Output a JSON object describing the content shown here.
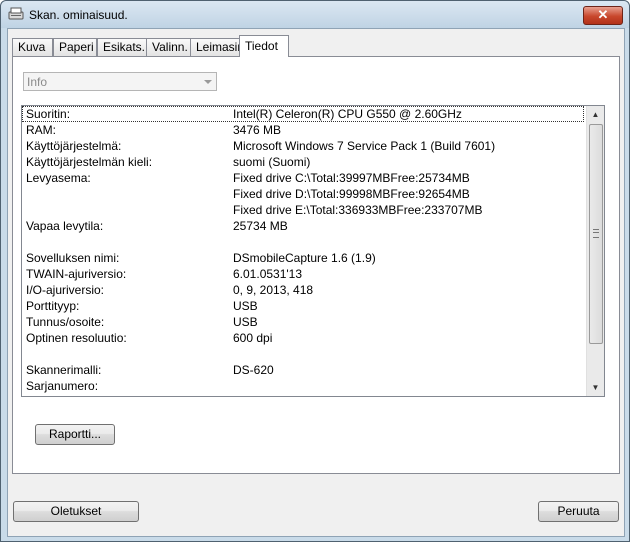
{
  "window": {
    "title": "Skan. ominaisuud.",
    "close_label": "✕"
  },
  "tabs": [
    {
      "label": "Kuva"
    },
    {
      "label": "Paperi"
    },
    {
      "label": "Esikats."
    },
    {
      "label": "Valinn."
    },
    {
      "label": "Leimasin"
    },
    {
      "label": "Tiedot",
      "active": true
    }
  ],
  "info_dropdown": {
    "selected": "Info"
  },
  "info_list": {
    "rows": [
      {
        "label": "Suoritin:",
        "value": "Intel(R) Celeron(R) CPU G550 @ 2.60GHz"
      },
      {
        "label": "RAM:",
        "value": "3476 MB"
      },
      {
        "label": "Käyttöjärjestelmä:",
        "value": "Microsoft Windows 7 Service Pack 1 (Build 7601)"
      },
      {
        "label": "Käyttöjärjestelmän kieli:",
        "value": "suomi (Suomi)"
      },
      {
        "label": "Levyasema:",
        "value": "Fixed drive C:\\Total:39997MBFree:25734MB"
      },
      {
        "label": "",
        "value": "Fixed drive D:\\Total:99998MBFree:92654MB"
      },
      {
        "label": "",
        "value": "Fixed drive E:\\Total:336933MBFree:233707MB"
      },
      {
        "label": "Vapaa levytila:",
        "value": "25734 MB"
      },
      {
        "label": "",
        "value": ""
      },
      {
        "label": "Sovelluksen nimi:",
        "value": " DSmobileCapture 1.6 (1.9)"
      },
      {
        "label": "TWAIN-ajuriversio:",
        "value": "6.01.0531'13"
      },
      {
        "label": "I/O-ajuriversio:",
        "value": "0, 9, 2013, 418"
      },
      {
        "label": "Porttityyp:",
        "value": "USB"
      },
      {
        "label": "Tunnus/osoite:",
        "value": "USB"
      },
      {
        "label": "Optinen resoluutio:",
        "value": "600 dpi"
      },
      {
        "label": "",
        "value": ""
      },
      {
        "label": "Skannerimalli:",
        "value": "DS-620"
      },
      {
        "label": "Sarjanumero:",
        "value": ""
      }
    ]
  },
  "buttons": {
    "report": "Raportti...",
    "defaults": "Oletukset",
    "cancel": "Peruuta"
  },
  "icons": {
    "app": "scanner-icon",
    "scroll_up": "▲",
    "scroll_down": "▼"
  }
}
